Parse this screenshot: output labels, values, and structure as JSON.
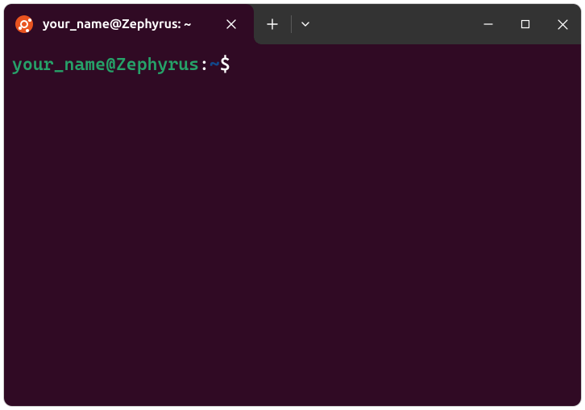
{
  "tab": {
    "title": "your_name@Zephyrus: ~",
    "icon": "ubuntu-logo"
  },
  "prompt": {
    "user_host": "your_name@Zephyrus",
    "separator": ":",
    "path": "~",
    "symbol": "$",
    "input": ""
  },
  "colors": {
    "terminal_bg": "#300a24",
    "titlebar_bg": "#333333",
    "user_host": "#26a269",
    "path": "#12488b",
    "text": "#ffffff",
    "ubuntu": "#E95420"
  }
}
